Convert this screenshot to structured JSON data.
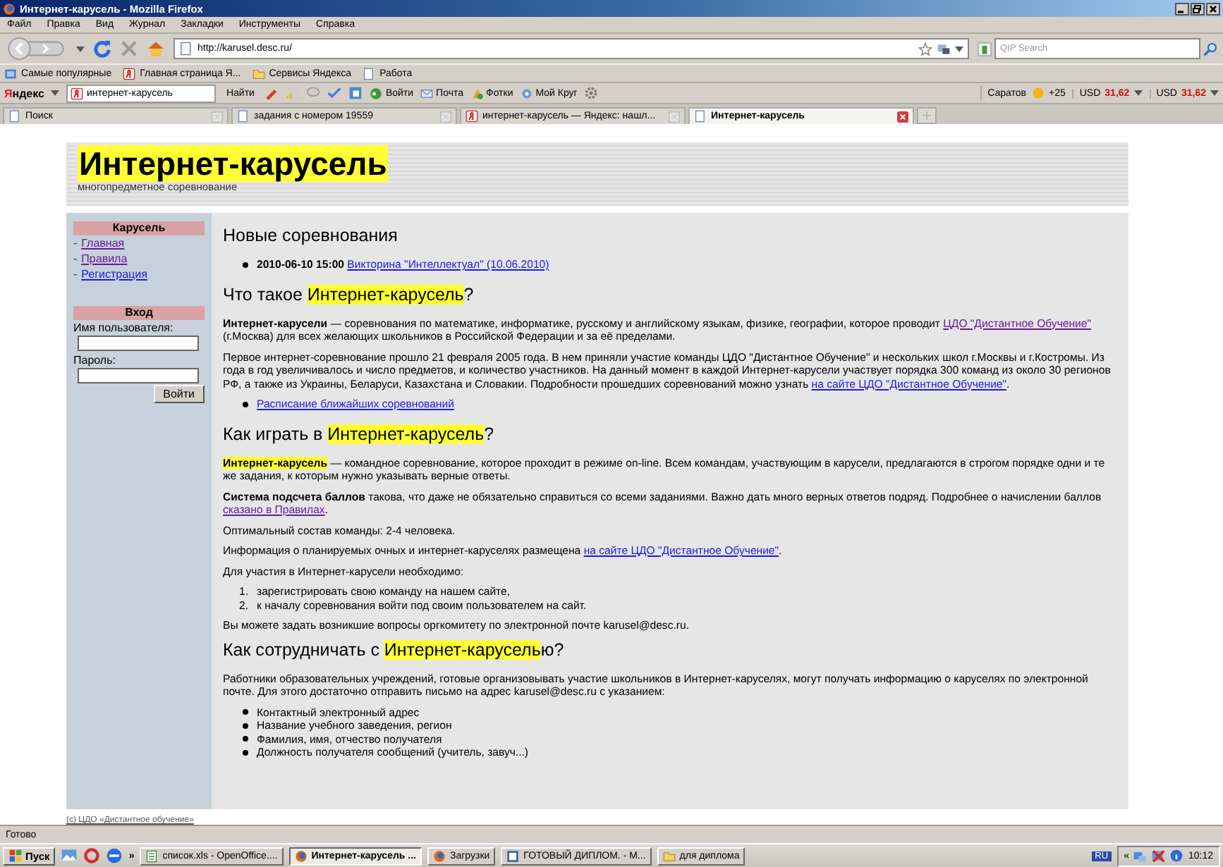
{
  "window": {
    "title": "Интернет-карусель - Mozilla Firefox"
  },
  "menu": [
    "Файл",
    "Правка",
    "Вид",
    "Журнал",
    "Закладки",
    "Инструменты",
    "Справка"
  ],
  "address_bar": {
    "url": "http://karusel.desc.ru/"
  },
  "search_box": {
    "placeholder": "QIP Search"
  },
  "bookmarks": [
    {
      "label": "Самые популярные",
      "kind": "smart"
    },
    {
      "label": "Главная страница Я...",
      "kind": "yandex"
    },
    {
      "label": "Сервисы Яндекса",
      "kind": "folder"
    },
    {
      "label": "Работа",
      "kind": "page"
    }
  ],
  "yandex_bar": {
    "logo": "Яндекс",
    "query": "интернет-карусель",
    "find_button": "Найти",
    "items": [
      {
        "label": "Войти",
        "kind": "login"
      },
      {
        "label": "Почта",
        "kind": "mail"
      },
      {
        "label": "Фотки",
        "kind": "photo"
      },
      {
        "label": "Мой Круг",
        "kind": "circle"
      }
    ],
    "city": "Саратов",
    "temperature": "+25",
    "rates": [
      {
        "currency": "USD",
        "value": "31,62"
      },
      {
        "currency": "USD",
        "value": "31,62"
      }
    ]
  },
  "tabs": [
    {
      "label": "Поиск",
      "selected": false
    },
    {
      "label": "задания с номером 19559",
      "selected": false
    },
    {
      "label": "интернет-карусель — Яндекс: нашл...",
      "selected": false
    },
    {
      "label": "Интернет-карусель",
      "selected": true
    }
  ],
  "page": {
    "site_title": "Интернет-карусель",
    "tagline": "многопредметное соревнование",
    "sidebar": {
      "menu_title": "Карусель",
      "links": [
        {
          "marker": "-",
          "label": "Главная",
          "visited": true
        },
        {
          "marker": "-",
          "label": "Правила",
          "visited": true
        },
        {
          "marker": "-",
          "label": "Регистрация",
          "visited": false
        }
      ],
      "login": {
        "title": "Вход",
        "username_label": "Имя пользователя:",
        "password_label": "Пароль:",
        "button": "Войти"
      }
    },
    "sections": [
      {
        "heading": {
          "text": "Новые соревнования"
        },
        "blocks": [
          {
            "kind": "bullets",
            "items": [
              [
                {
                  "text": "2010-06-10 15:00 ",
                  "kind": "bold"
                },
                {
                  "text": "Викторина \"Интеллектуал\" (10.06.2010)",
                  "kind": "link",
                  "visited": false
                }
              ]
            ]
          }
        ]
      },
      {
        "heading": {
          "text": "Что такое ",
          "highlight": "Интернет-карусель",
          "after": "?"
        },
        "blocks": [
          {
            "kind": "para",
            "segments": [
              {
                "text": "Интернет-карусели",
                "kind": "bold"
              },
              {
                "text": " — соревнования по математике, информатике, русскому и английскому языкам, физике, географии, которое проводит "
              },
              {
                "text": "ЦДО \"Дистантное Обучение\"",
                "kind": "link",
                "visited": true
              },
              {
                "text": " (г.Москва) для всех желающих школьников в Российской Федерации и за её пределами."
              }
            ]
          },
          {
            "kind": "para",
            "segments": [
              {
                "text": "Первое интернет-соревнование прошло 21 февраля 2005 года. В нем приняли участие команды ЦДО \"Дистантное Обучение\" и нескольких школ г.Москвы и г.Костромы. Из года в год увеличивалось и число предметов, и количество участников. На данный момент в каждой Интернет-карусели участвует порядка 300 команд из около 30 регионов РФ, а также из Украины, Беларуси, Казахстана и Словакии. Подробности прошедших соревнований можно узнать "
              },
              {
                "text": "на сайте ЦДО \"Дистантное Обучение\"",
                "kind": "link",
                "visited": false
              },
              {
                "text": "."
              }
            ]
          },
          {
            "kind": "bullets",
            "items": [
              [
                {
                  "text": "Расписание ближайших соревнований",
                  "kind": "link",
                  "visited": false
                }
              ]
            ]
          }
        ]
      },
      {
        "heading": {
          "text": "Как играть в ",
          "highlight": "Интернет-карусель",
          "after": "?"
        },
        "blocks": [
          {
            "kind": "para",
            "segments": [
              {
                "text": "Интернет-карусель",
                "kind": "mark"
              },
              {
                "text": " — командное соревнование, которое проходит в режиме on-line. Всем командам, участвующим в карусели, предлагаются в строгом порядке одни и те же задания, к которым нужно указывать верные ответы."
              }
            ]
          },
          {
            "kind": "para",
            "segments": [
              {
                "text": "Система подсчета баллов",
                "kind": "bold"
              },
              {
                "text": " такова, что даже не обязательно справиться со всеми заданиями. Важно дать много верных ответов подряд. Подробнее о начислении баллов "
              },
              {
                "text": "сказано в Правилах",
                "kind": "link",
                "visited": true
              },
              {
                "text": "."
              }
            ]
          },
          {
            "kind": "para",
            "segments": [
              {
                "text": "Оптимальный состав команды: 2-4 человека."
              }
            ]
          },
          {
            "kind": "para",
            "segments": [
              {
                "text": "Информация о планируемых очных и интернет-каруселях размещена "
              },
              {
                "text": "на сайте ЦДО \"Дистантное Обучение\"",
                "kind": "link",
                "visited": false
              },
              {
                "text": "."
              }
            ]
          },
          {
            "kind": "para",
            "segments": [
              {
                "text": "Для участия в Интернет-карусели необходимо:"
              }
            ]
          },
          {
            "kind": "numbered",
            "items": [
              {
                "number": "1.",
                "text": "зарегистрировать свою команду на нашем сайте,"
              },
              {
                "number": "2.",
                "text": "к началу соревнования войти под своим пользователем на сайт."
              }
            ]
          },
          {
            "kind": "para",
            "segments": [
              {
                "text": "Вы можете задать возникшие вопросы оргкомитету по электронной почте karusel@desc.ru."
              }
            ]
          }
        ]
      },
      {
        "heading": {
          "text": "Как сотрудничать с ",
          "highlight": "Интернет-карусель",
          "after": "ю?"
        },
        "blocks": [
          {
            "kind": "para",
            "segments": [
              {
                "text": "Работники образовательных учреждений, готовые организовывать участие школьников в Интернет-каруселях, могут получать информацию о каруселях по электронной почте. Для этого достаточно отправить письмо на адрес karusel@desc.ru с указанием:"
              }
            ]
          },
          {
            "kind": "bullets",
            "items": [
              [
                {
                  "text": "Контактный электронный адрес"
                }
              ],
              [
                {
                  "text": "Название учебного заведения, регион"
                }
              ],
              [
                {
                  "text": "Фамилия, имя, отчество получателя"
                }
              ],
              [
                {
                  "text": "Должность получателя сообщений (учитель, завуч...)"
                }
              ]
            ]
          }
        ]
      }
    ],
    "footer": "(c) ЦДО «Дистантное обучение»"
  },
  "status_bar": {
    "text": "Готово"
  },
  "taskbar": {
    "start": "Пуск",
    "overflow": "»",
    "tasks": [
      {
        "label": "список.xls - OpenOffice....",
        "kind": "sheet",
        "selected": false
      },
      {
        "label": "Интернет-карусель ...",
        "kind": "browser",
        "selected": true
      },
      {
        "label": "Загрузки",
        "kind": "browser",
        "selected": false
      },
      {
        "label": "ГОТОВЫЙ ДИПЛОМ. - М...",
        "kind": "doc",
        "selected": false
      },
      {
        "label": "для диплома",
        "kind": "folder",
        "selected": false
      }
    ],
    "language": "RU",
    "tray_toggle": "«",
    "clock": "10:12"
  }
}
